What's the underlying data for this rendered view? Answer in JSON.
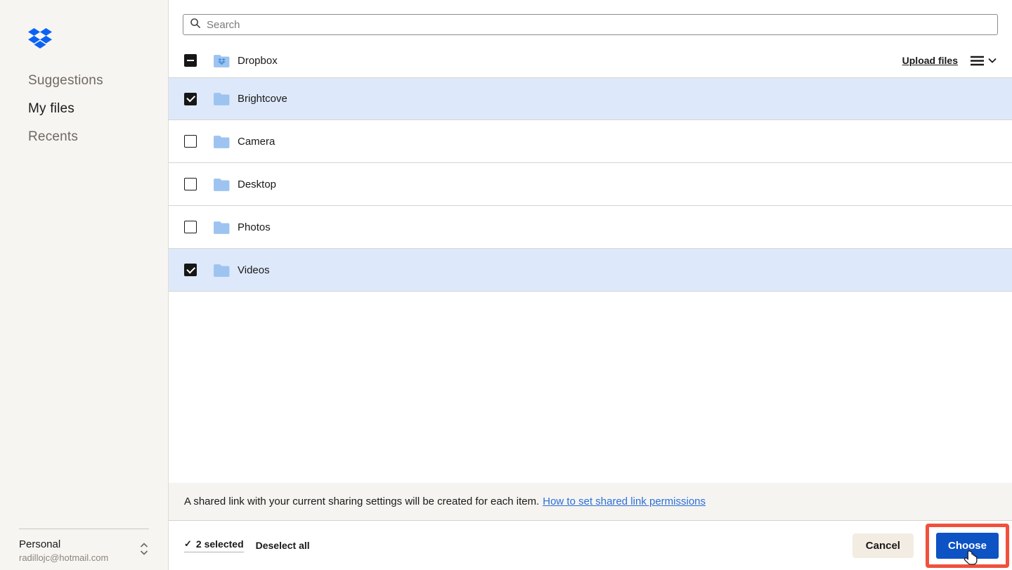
{
  "sidebar": {
    "items": [
      {
        "label": "Suggestions",
        "active": false
      },
      {
        "label": "My files",
        "active": true
      },
      {
        "label": "Recents",
        "active": false
      }
    ],
    "account": {
      "name": "Personal",
      "email": "radillojc@hotmail.com"
    }
  },
  "search": {
    "placeholder": "Search"
  },
  "toolbar": {
    "root_label": "Dropbox",
    "root_checkbox_state": "indeterminate",
    "upload_label": "Upload files"
  },
  "folders": [
    {
      "name": "Brightcove",
      "checked": true
    },
    {
      "name": "Camera",
      "checked": false
    },
    {
      "name": "Desktop",
      "checked": false
    },
    {
      "name": "Photos",
      "checked": false
    },
    {
      "name": "Videos",
      "checked": true
    }
  ],
  "info_bar": {
    "message": "A shared link with your current sharing settings will be created for each item.",
    "link_label": "How to set shared link permissions"
  },
  "footer": {
    "check_icon": "✓",
    "selected_label": "2 selected",
    "deselect_label": "Deselect all",
    "cancel_label": "Cancel",
    "choose_label": "Choose"
  },
  "colors": {
    "brand_blue": "#0a62f5",
    "choose_button_blue": "#0d53c4",
    "selected_row_blue": "#dde9fa",
    "folder_icon_blue": "#9dc4f0",
    "annotation_red": "#f0503c",
    "link_blue": "#2c6fd6",
    "sidebar_bg": "#f7f5f2"
  }
}
